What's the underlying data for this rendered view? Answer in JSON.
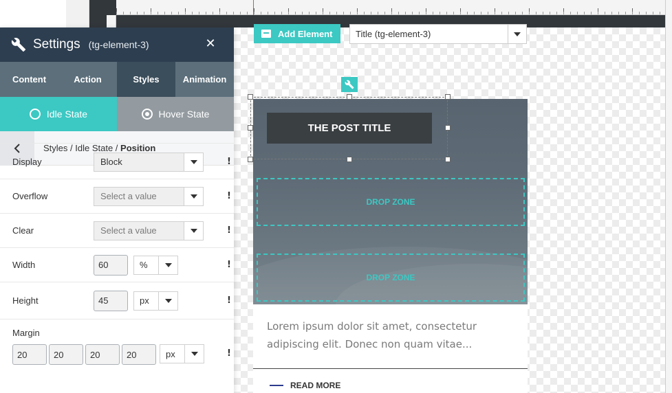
{
  "panel": {
    "title": "Settings",
    "subtitle": "(tg-element-3)",
    "close_glyph": "✕",
    "tabs": [
      {
        "label": "Content"
      },
      {
        "label": "Action"
      },
      {
        "label": "Styles"
      },
      {
        "label": "Animation"
      }
    ],
    "states": {
      "idle": "Idle State",
      "hover": "Hover State"
    },
    "breadcrumb": {
      "part1": "Styles",
      "sep": " / ",
      "part2": "Idle State",
      "part3": "Position"
    },
    "properties": {
      "display": {
        "label": "Display",
        "value": "Block"
      },
      "overflow": {
        "label": "Overflow",
        "placeholder": "Select a value"
      },
      "clear": {
        "label": "Clear",
        "placeholder": "Select a value"
      },
      "width": {
        "label": "Width",
        "value": "60",
        "unit": "%"
      },
      "height": {
        "label": "Height",
        "value": "45",
        "unit": "px"
      },
      "margin": {
        "label": "Margin",
        "top": "20",
        "right": "20",
        "bottom": "20",
        "left": "20",
        "unit": "px"
      }
    },
    "important_glyph": "!"
  },
  "toolbar": {
    "add_element_label": "Add Element",
    "element_select_value": "Title (tg-element-3)"
  },
  "card": {
    "title": "THE POST TITLE",
    "drop_zone_1": "DROP ZONE",
    "drop_zone_2": "DROP ZONE",
    "excerpt": "Lorem ipsum dolor sit amet, consectetur adipiscing elit. Donec non quam vitae...",
    "read_more": "READ MORE"
  },
  "colors": {
    "accent": "#3cc8c3",
    "header": "#2d3e50",
    "tabs": "#5c6f7b",
    "tab_active": "#3b4e5b",
    "hover_state": "#939ba0"
  },
  "icons": [
    "wrench-icon",
    "close-icon",
    "chevron-left-icon",
    "caret-down-icon",
    "add-element-icon"
  ]
}
